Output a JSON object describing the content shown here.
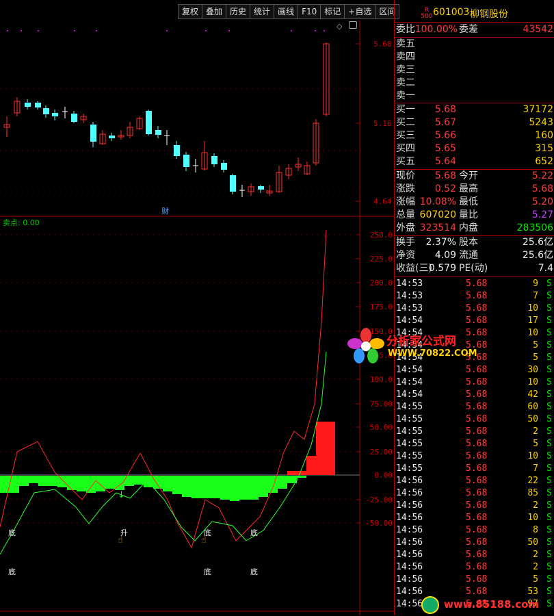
{
  "toolbar": {
    "buttons": [
      "复权",
      "叠加",
      "历史",
      "统计",
      "画线",
      "F10",
      "标记",
      "+自选",
      "区间"
    ]
  },
  "stock": {
    "badge_top": "R",
    "badge_bottom": "500",
    "code": "601003",
    "name": "柳钢股份"
  },
  "main_chart": {
    "y_labels": [
      "5.68",
      "5.16",
      "4.64"
    ],
    "annotation": "财"
  },
  "indicator": {
    "title": "卖点: 0.00",
    "y_labels": [
      "250.0",
      "225.0",
      "200.0",
      "175.0",
      "150.0",
      "125.0",
      "100.0",
      "75.00",
      "50.00",
      "25.00",
      "0.00",
      "-25.00",
      "-50.00"
    ],
    "markers_upper": [
      "底",
      "升",
      "底",
      "底"
    ],
    "markers_lower": [
      "底",
      "底",
      "底"
    ]
  },
  "order_book": {
    "wei_bi_label": "委比",
    "wei_bi": "100.00%",
    "wei_cha_label": "委差",
    "wei_cha": "43542",
    "asks": [
      {
        "label": "卖五",
        "price": "",
        "vol": ""
      },
      {
        "label": "卖四",
        "price": "",
        "vol": ""
      },
      {
        "label": "卖三",
        "price": "",
        "vol": ""
      },
      {
        "label": "卖二",
        "price": "",
        "vol": ""
      },
      {
        "label": "卖一",
        "price": "",
        "vol": ""
      }
    ],
    "bids": [
      {
        "label": "买一",
        "price": "5.68",
        "vol": "37172"
      },
      {
        "label": "买二",
        "price": "5.67",
        "vol": "5243"
      },
      {
        "label": "买三",
        "price": "5.66",
        "vol": "160"
      },
      {
        "label": "买四",
        "price": "5.65",
        "vol": "315"
      },
      {
        "label": "买五",
        "price": "5.64",
        "vol": "652"
      }
    ]
  },
  "quote": {
    "rows": [
      {
        "l1": "现价",
        "v1": "5.68",
        "c1": "red",
        "l2": "今开",
        "v2": "5.22",
        "c2": "red"
      },
      {
        "l1": "涨跌",
        "v1": "0.52",
        "c1": "red",
        "l2": "最高",
        "v2": "5.68",
        "c2": "red"
      },
      {
        "l1": "涨幅",
        "v1": "10.08%",
        "c1": "red",
        "l2": "最低",
        "v2": "5.20",
        "c2": "red"
      },
      {
        "l1": "总量",
        "v1": "607020",
        "c1": "yel",
        "l2": "量比",
        "v2": "5.27",
        "c2": "pur"
      },
      {
        "l1": "外盘",
        "v1": "323514",
        "c1": "red",
        "l2": "内盘",
        "v2": "283506",
        "c2": "grn"
      }
    ],
    "rows2": [
      {
        "l1": "换手",
        "v1": "2.37%",
        "l2": "股本",
        "v2": "25.6亿"
      },
      {
        "l1": "净资",
        "v1": "4.09",
        "l2": "流通",
        "v2": "25.6亿"
      },
      {
        "l1": "收益(三)",
        "v1": "0.579",
        "l2": "PE(动)",
        "v2": "7.4"
      }
    ]
  },
  "ticks": [
    {
      "t": "14:53",
      "p": "5.68",
      "v": "9",
      "s": "S"
    },
    {
      "t": "14:53",
      "p": "5.68",
      "v": "7",
      "s": "S"
    },
    {
      "t": "14:53",
      "p": "5.68",
      "v": "10",
      "s": "S"
    },
    {
      "t": "14:54",
      "p": "5.68",
      "v": "17",
      "s": "S"
    },
    {
      "t": "14:54",
      "p": "5.68",
      "v": "10",
      "s": "S"
    },
    {
      "t": "14:54",
      "p": "5.68",
      "v": "5",
      "s": "S"
    },
    {
      "t": "14:54",
      "p": "5.68",
      "v": "5",
      "s": "S"
    },
    {
      "t": "14:54",
      "p": "5.68",
      "v": "30",
      "s": "S"
    },
    {
      "t": "14:54",
      "p": "5.68",
      "v": "10",
      "s": "S"
    },
    {
      "t": "14:54",
      "p": "5.68",
      "v": "42",
      "s": "S"
    },
    {
      "t": "14:55",
      "p": "5.68",
      "v": "60",
      "s": "S"
    },
    {
      "t": "14:55",
      "p": "5.68",
      "v": "50",
      "s": "S"
    },
    {
      "t": "14:55",
      "p": "5.68",
      "v": "2",
      "s": "S"
    },
    {
      "t": "14:55",
      "p": "5.68",
      "v": "5",
      "s": "S"
    },
    {
      "t": "14:55",
      "p": "5.68",
      "v": "10",
      "s": "S"
    },
    {
      "t": "14:55",
      "p": "5.68",
      "v": "7",
      "s": "S"
    },
    {
      "t": "14:56",
      "p": "5.68",
      "v": "22",
      "s": "S"
    },
    {
      "t": "14:56",
      "p": "5.68",
      "v": "85",
      "s": "S"
    },
    {
      "t": "14:56",
      "p": "5.68",
      "v": "2",
      "s": "S"
    },
    {
      "t": "14:56",
      "p": "5.68",
      "v": "10",
      "s": "S"
    },
    {
      "t": "14:56",
      "p": "5.68",
      "v": "8",
      "s": "S"
    },
    {
      "t": "14:56",
      "p": "5.68",
      "v": "50",
      "s": "S"
    },
    {
      "t": "14:56",
      "p": "5.68",
      "v": "2",
      "s": "S"
    },
    {
      "t": "14:56",
      "p": "5.68",
      "v": "2",
      "s": "S"
    },
    {
      "t": "14:56",
      "p": "5.68",
      "v": "5",
      "s": "S"
    },
    {
      "t": "14:56",
      "p": "5.68",
      "v": "53",
      "s": "S"
    },
    {
      "t": "14:56",
      "p": "5.68",
      "v": "97",
      "s": "S"
    }
  ],
  "watermark": {
    "title": "分析家公式网",
    "url": "WWW.70822.COM",
    "bottom": "www.85188.com"
  }
}
